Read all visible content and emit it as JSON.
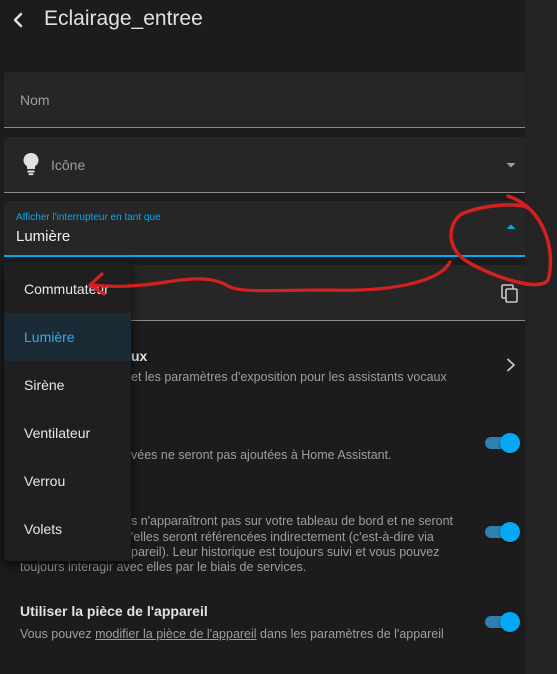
{
  "header": {
    "title": "Eclairage_entree"
  },
  "fields": {
    "name_placeholder": "Nom",
    "icon_placeholder": "Icône",
    "switch_label": "Afficher l'interrupteur en tant que",
    "switch_value": "Lumière"
  },
  "menu": {
    "items": [
      "Commutateur",
      "Lumière",
      "Sirène",
      "Ventilateur",
      "Verrou",
      "Volets"
    ],
    "selected": "Lumière"
  },
  "rows": {
    "voice_heading_partial": "ux",
    "voice_desc_partial": "et les paramètres d'exposition pour les assistants vocaux",
    "enabled_desc_partial": "vées ne seront pas ajoutées à Home Assistant.",
    "visible_line1": "s n'apparaîtront pas sur votre tableau de bord et ne seront",
    "visible_line2": "'elles seront référencées indirectement (c'est-à-dire via",
    "visible_line3": "pareil). Leur historique est toujours suivi et vous pouvez",
    "visible_line4": "toujours interagir avec elles par le biais de services.",
    "area_heading": "Utiliser la pièce de l'appareil",
    "area_desc_before": "Vous pouvez ",
    "area_desc_link": "modifier la pièce de l'appareil",
    "area_desc_after": " dans les paramètres de l'appareil"
  },
  "toggles": {
    "enabled": true,
    "visible": true,
    "use_device_area": true
  },
  "colors": {
    "accent": "#03a9f4",
    "annotation": "#d42020",
    "background": "#1c1c1c"
  },
  "icons": [
    "chevron-left-icon",
    "lightbulb-icon",
    "menu-down-icon",
    "menu-up-icon",
    "content-copy-icon",
    "chevron-right-icon"
  ]
}
